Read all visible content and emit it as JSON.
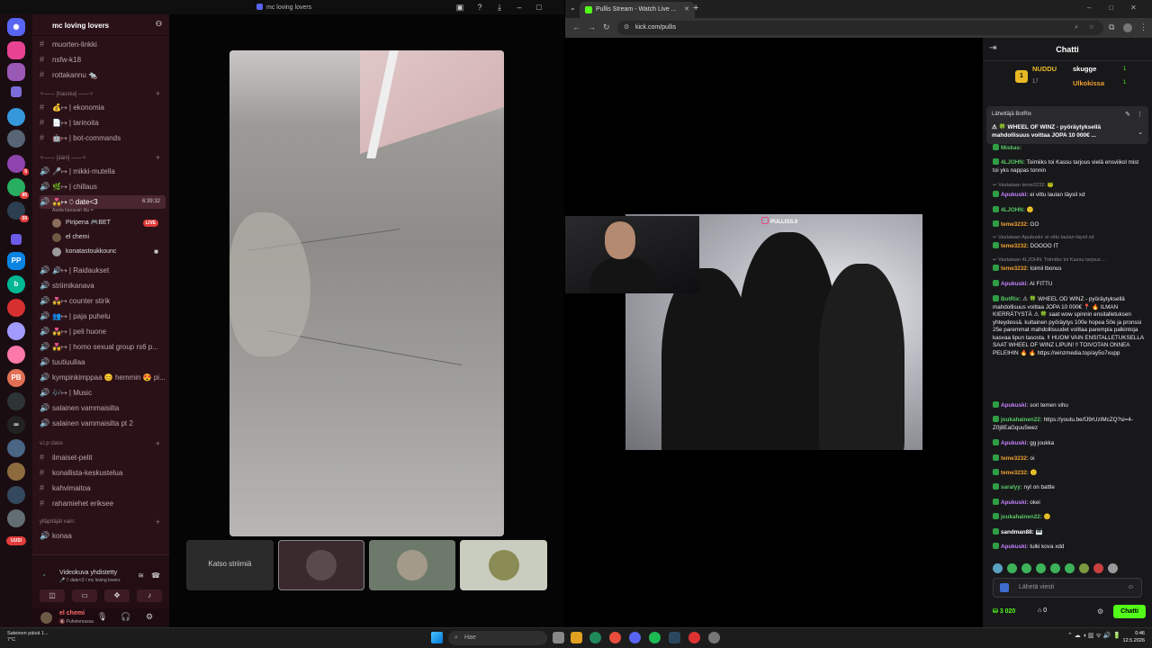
{
  "discord": {
    "window_title": "mc loving lovers",
    "guild_name": "mc loving lovers",
    "channels_top": [
      {
        "label": "muorten-linkki"
      },
      {
        "label": "nsfw-k18"
      },
      {
        "label": "rottakannu 🐀"
      }
    ],
    "category_hauska": "✧—— [hauska] ——✧",
    "channels_hauska": [
      {
        "label": "💰↦ | ekonomia"
      },
      {
        "label": "📄↦ | tarinoita"
      },
      {
        "label": "🤖↦ | bot-commands"
      }
    ],
    "category_aani": "✧—— [ääni] ——✧",
    "channels_aani": [
      {
        "label": "🎤↦ | mikki-mutella"
      },
      {
        "label": "🌿↦ | chillaus"
      },
      {
        "label": "💑↦ ⍥ date<3",
        "time": "6:39:32"
      }
    ],
    "channel_status": "Aseta kanavan tila ✏",
    "voice_users": [
      {
        "name": "Piripena 🎮BET",
        "live": "LIVE"
      },
      {
        "name": "el chemi"
      },
      {
        "name": "konatastoukkounc"
      }
    ],
    "channels_more": [
      {
        "label": "🔊↦ | Raidaukset"
      },
      {
        "label": "striimikanava"
      },
      {
        "label": "💑↦ counter stirik"
      },
      {
        "label": "👥↦ | paja puhelu"
      },
      {
        "label": "💑↦ | peli huone"
      },
      {
        "label": "💑↦ | homo sexual group rs6 p..."
      },
      {
        "label": "tuutiuullaa"
      },
      {
        "label": "kympinkimppaa 😊 hemmin 😍 pi..."
      },
      {
        "label": "🎶↦ | Music"
      },
      {
        "label": "salainen vammaisilta"
      },
      {
        "label": "salainen vammaisilta pt 2"
      }
    ],
    "category_vip": "v.i.p class",
    "channels_vip": [
      {
        "label": "ilmaiset-pelit"
      },
      {
        "label": "konallista-keskustelua"
      },
      {
        "label": "kahvimaitoa"
      },
      {
        "label": "rahamiehet eriksee"
      }
    ],
    "category_admin": "ylläpitäjät vain:",
    "channels_admin": [
      {
        "label": "konaa"
      }
    ],
    "voice_connected": "Videokuva yhdistetty",
    "voice_sub": "🎤 ⍥ date<3 / mc loving lovers",
    "user_name": "el chemi",
    "user_status": "🔇 Puhelemassa",
    "new_badge": "UUSI",
    "watch_stream": "Katso striimiä"
  },
  "browser": {
    "tab_title": "Pullis Stream - Watch Live ...",
    "url": "kick.com/pullis",
    "stream_tag": "PULLISS.0"
  },
  "chat": {
    "title": "Chatti",
    "leaderboard": [
      {
        "rank": "1",
        "name": "NUDDU",
        "count": "17",
        "color": "#e8b923"
      },
      {
        "name": "skugge",
        "count": "1",
        "color": "#ffffff"
      },
      {
        "name": "Ulkokissa",
        "count": "1",
        "color": "#f0a030"
      }
    ],
    "pinned_by": "Lähettäjä BotRix",
    "pinned_text": "⚠ 🍀 WHEEL OF WINZ - pyöräytyksellä mahdollisuus voittaa JOPA 10 000€ ...",
    "messages": [
      {
        "user": "Miskas:",
        "text": "",
        "color": "#58c866"
      },
      {
        "user": "4LJOHN:",
        "text": " Toimiiks toi Kassu tarjous vielä ensviikol mist toi yks nappas tonnin",
        "color": "#58c866"
      },
      {
        "reply": "↩ Vastataan teme3232: 🐸"
      },
      {
        "user": "Apukuski:",
        "text": " ei vittu laulan täysil xd",
        "color": "#c783ff"
      },
      {
        "user": "4LJOHN:",
        "text": " 🙂",
        "color": "#58c866"
      },
      {
        "user": "teme3232:",
        "text": " GO",
        "color": "#f0a030"
      },
      {
        "reply": "↩ Vastataan Apukuski: ei vittu laulan täysil xd"
      },
      {
        "user": "teme3232:",
        "text": " DOOOO IT",
        "color": "#f0a030"
      },
      {
        "reply": "↩ Vastataan 4LJOHN: Toimiiks toi Kassu tarjous ..."
      },
      {
        "user": "teme3232:",
        "text": " toimii lbonus",
        "color": "#f0a030"
      },
      {
        "user": "Apukuski:",
        "text": " AI FITTU",
        "color": "#c783ff"
      },
      {
        "user": "BotRix:",
        "text": " ⚠ 🍀 WHEEL OD WINZ - pyöräytyksellä mahdollisuus voittaa JOPA 10 000€ 📍 🔥 ILMAN KIERRÄTYSTÄ ⚠ 🍀 saat wow spinnin ensitalletuksen yhteydessä. kultainen pyöräytys 100e hopea 50e ja pronssi 25e paremmat mahdollisuudet voittaa parempia palkintoja kasvaa lipun tasosta. ‼ HUOM VAIN ENSITALLETUKSELLA SAAT WHEEL OF WINZ LIPUN! ‼ TOIVOTAN ONNEA PELEIHIN 🔥 🔥 https://winzmedia.top/ay5o7xupp",
        "color": "#58c866"
      },
      {
        "user": "Apukuski:",
        "text": " sori temen vihu",
        "color": "#c783ff"
      },
      {
        "user": "joukahainen22:",
        "text": " https://youtu.be/fJ9rUzIMcZQ?si=4-Z0j8EaGquu5wez",
        "color": "#58c866"
      },
      {
        "user": "Apukuski:",
        "text": " gg joukka",
        "color": "#c783ff"
      },
      {
        "user": "teme3232:",
        "text": " oi",
        "color": "#f0a030"
      },
      {
        "user": "teme3232:",
        "text": " 🙂",
        "color": "#f0a030"
      },
      {
        "user": "saralyy:",
        "text": " nyt on battle",
        "color": "#58c866"
      },
      {
        "user": "Apukuski:",
        "text": " okei",
        "color": "#c783ff"
      },
      {
        "user": "joukahainen22:",
        "text": " 🙂",
        "color": "#58c866"
      },
      {
        "user": "sandman88:",
        "text": " 🎹",
        "color": "#ffffff"
      },
      {
        "user": "Apukuski:",
        "text": " tulki kova xdd",
        "color": "#c783ff"
      }
    ],
    "input_placeholder": "Lähetä viesti",
    "points": "3 020",
    "gifts": "0",
    "send_label": "Chatti"
  },
  "taskbar": {
    "weather_line1": "Sateinen päivä 1...",
    "weather_line2": "7°C",
    "search_placeholder": "Hae",
    "time": "0:46",
    "date": "12.5.2026"
  },
  "colors": {
    "kick_green": "#53fc18",
    "discord_sidebar": "#2a1118",
    "chat_bg": "#18181b"
  }
}
